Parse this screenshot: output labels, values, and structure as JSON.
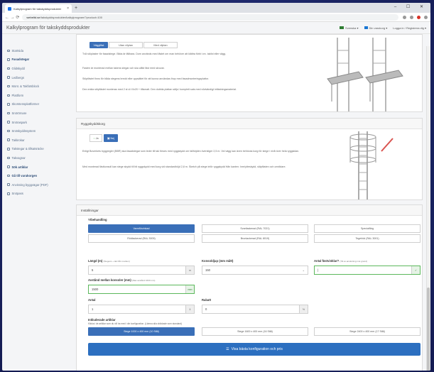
{
  "browser": {
    "tab_title": "Kalkylprogram för takskyddsprodukter",
    "tab_close": "×",
    "new_tab": "+",
    "window_controls": "– ☐ ✕",
    "url_host": "webeltd.se",
    "url_path": "/takskyddsprodukter/kalkylprogram/?product=100",
    "nav": "← → ⟳"
  },
  "site": {
    "title": "Kalkylprogram för takskyddsprodukter",
    "lang": "Svenska ▾",
    "cart": "Din varukorg ▾",
    "login": "Logga in / Registrera dig ▾"
  },
  "sidebar": {
    "items": [
      {
        "label": "Startsida"
      },
      {
        "label": "Fasadstegar"
      },
      {
        "label": "Glidskydd"
      },
      {
        "label": "Ledbergs"
      },
      {
        "label": "Mont. & Takfotsblock"
      },
      {
        "label": "Plattform"
      },
      {
        "label": "Skorstensplattformer"
      },
      {
        "label": "Snörörnare"
      },
      {
        "label": "Snöraspark"
      },
      {
        "label": "Snöskyddssystem"
      },
      {
        "label": "Takkrokar"
      },
      {
        "label": "Takstegar & tillsatsräcke"
      },
      {
        "label": "Takvagnar"
      },
      {
        "label": "Sök artiklar"
      },
      {
        "label": "Gå till varukorgen"
      },
      {
        "label": "Anvisning byggvägar (PDF)"
      },
      {
        "label": "Snöpass"
      }
    ]
  },
  "top_card": {
    "tab1": "Väggfäst",
    "tab2": "Utan vilplan",
    "tab3": "Med vilplan",
    "p1": "Två stöplaster för fasadstege. Bilda är fällbara. Dom används med fästet om man behöver att klättra förbi t.ex. takfot eller vägg.",
    "p2": "Fasten är monterad mellan takens stegar och ska alltid fäst med skruvar.",
    "p3": "Stöpfästet finns för båda stegens bredd eller uppsättet för att kunna användas ihop med fasadmonteringsplattor.",
    "p4": "Den enkla stöpfästet monteras med 2 st vl.f.0x20 + tillsmatt. Den dubbla plattan säljs i komplett sats med nödvändigt infästningsmaterial."
  },
  "rygg_card": {
    "heading": "Ryggskyddskorg",
    "opt_yes": "Ja",
    "opt_no": "Nej",
    "p1": "Enligt Boverkets byggregler (BBR) ska fasadstegar som leder till tak förses med ryggskydd om fallhöjden överstiger 2,5 m. Vid vägg kan även behövas korg för stege i nivå över hela ryggsidan.",
    "p2": "Med monterad fästkonsoll kan stege skydd till bli ryggskydd med korg vid standardhöjd 2,8 m. Sketch på stege inför ryggskydd från kanten: Inre/ytteskydd, släpfästen och omriktare."
  },
  "settings": {
    "heading": "Inställningar",
    "surface_label": "Ytbehandling",
    "surfaces": [
      "Varmförzinkad",
      "Svartlackerad (RAL 7021)",
      "Specialfärg",
      "Rödlackerad (RAL 3009)",
      "Brunlackerad (RAL 8019)",
      "Tegelröd (RAL 3001)"
    ],
    "length_label": "Längd (m)",
    "length_hint": "(Stegens + tak från marken)",
    "length_value": "5",
    "length_unit": "m",
    "console_label": "Konsoldjup (mm mått)",
    "console_value": "150",
    "count_label": "Antal fästvinklar?",
    "count_hint": "(Till ex.anslutning mot grund)",
    "count_value": "|",
    "dist_label": "Avstånd mellan konsoler (mm)",
    "dist_hint": "(Max avstånd 1600 mm)",
    "dist_value": "1500",
    "dist_unit": "mm",
    "antal_label": "Antal",
    "antal_value": "1",
    "rabatt_label": "Rabatt",
    "rabatt_value": "0",
    "rabatt_unit": "%",
    "incl_label": "Inkluderade artiklar",
    "incl_hint": "Klicka i de artiklar som du vill ha med i din konfiguration. (Lämna alla oklickade som standard)",
    "incl_opts": [
      "Stege 1000 x 400 mm (10 Stål)",
      "Stege 1600 x 400 mm (16 Stål)",
      "Stege 2400 x 400 mm (17 Stål)"
    ],
    "cta": "Visa bästa konfiguration och pris"
  },
  "colors": {
    "accent": "#3a6fb8",
    "cta": "#2c6fc0",
    "sidebar_text": "#5a6f8a"
  }
}
